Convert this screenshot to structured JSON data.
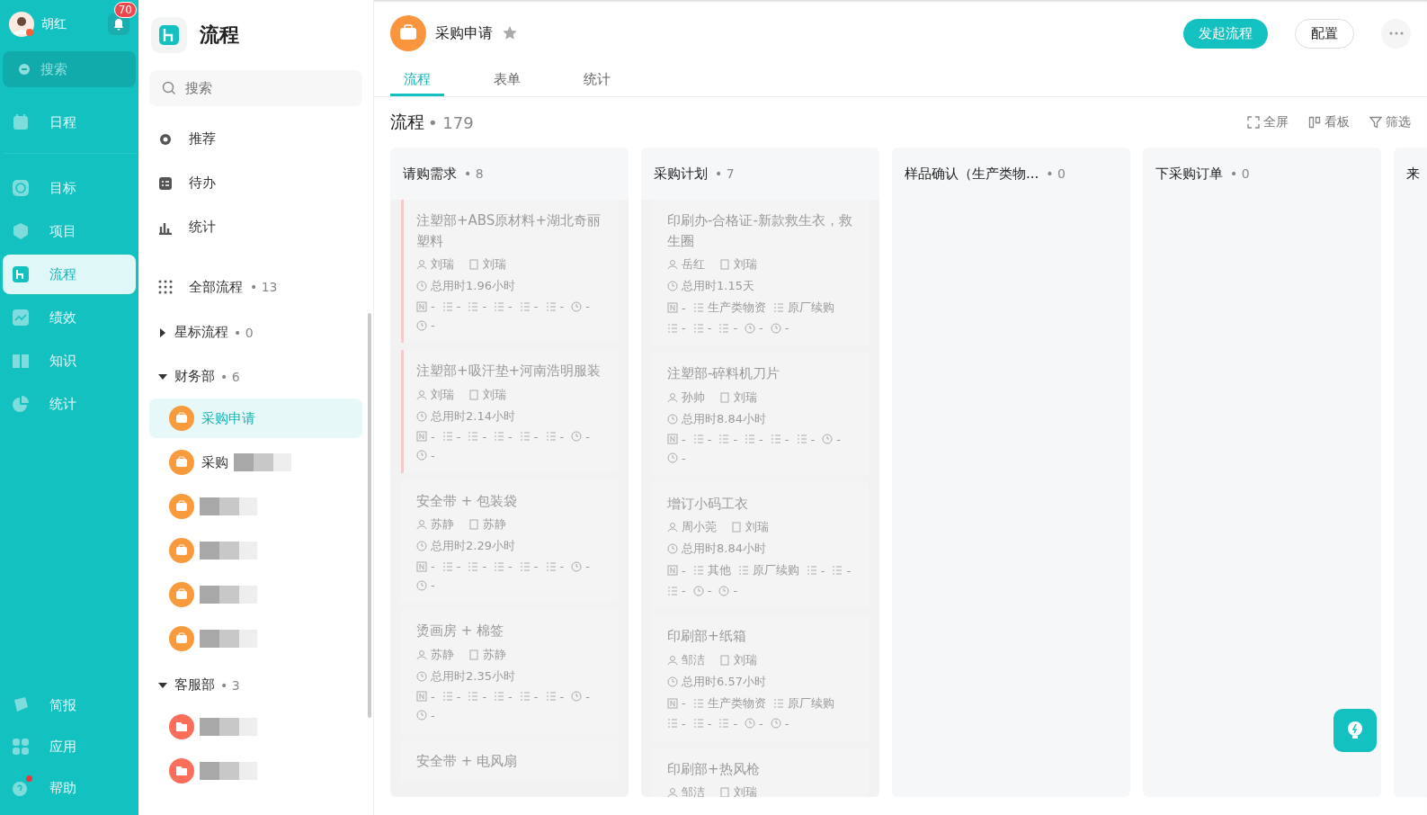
{
  "user": {
    "name": "胡红",
    "notifications": "70"
  },
  "nav": {
    "search": "搜索",
    "items": [
      {
        "label": "日程",
        "selected": false
      },
      {
        "label": "目标",
        "selected": false
      },
      {
        "label": "项目",
        "selected": false
      },
      {
        "label": "流程",
        "selected": true
      },
      {
        "label": "绩效",
        "selected": false
      },
      {
        "label": "知识",
        "selected": false
      },
      {
        "label": "统计",
        "selected": false
      }
    ],
    "bottom": [
      {
        "label": "简报",
        "selected": false,
        "dot": false
      },
      {
        "label": "应用",
        "selected": false,
        "dot": false
      },
      {
        "label": "帮助",
        "selected": false,
        "dot": true
      }
    ]
  },
  "panel": {
    "title": "流程",
    "search_placeholder": "搜索",
    "links": [
      {
        "label": "推荐"
      },
      {
        "label": "待办"
      },
      {
        "label": "统计"
      }
    ],
    "all": {
      "label": "全部流程",
      "count": "• 13"
    },
    "groups": [
      {
        "name": "星标流程",
        "count": "• 0",
        "expanded": false
      },
      {
        "name": "财务部",
        "count": "• 6",
        "expanded": true,
        "children": [
          {
            "label": "采购申请",
            "selected": true,
            "redacted": false
          },
          {
            "label": "采购",
            "selected": false,
            "redacted": true
          },
          {
            "selected": false,
            "redacted": true
          },
          {
            "selected": false,
            "redacted": true
          },
          {
            "selected": false,
            "redacted": true
          },
          {
            "selected": false,
            "redacted": true
          }
        ]
      },
      {
        "name": "客服部",
        "count": "• 3",
        "expanded": true,
        "children": [
          {
            "selected": false,
            "redacted": true
          },
          {
            "selected": false,
            "redacted": true
          }
        ]
      }
    ]
  },
  "header": {
    "title": "采购申请",
    "starred": false,
    "buttons": [
      {
        "label": "发起流程",
        "kind": "primary"
      },
      {
        "label": "配置",
        "kind": "outline"
      }
    ]
  },
  "tabs": [
    {
      "label": "流程",
      "selected": true
    },
    {
      "label": "表单",
      "selected": false
    },
    {
      "label": "统计",
      "selected": false
    }
  ],
  "board": {
    "title": "流程",
    "count": "• 179",
    "tools": [
      {
        "label": "全屏"
      },
      {
        "label": "看板"
      },
      {
        "label": "筛选"
      }
    ],
    "columns": [
      {
        "name": "请购需求",
        "count": "• 8",
        "cards": [
          {
            "title": "注塑部+ABS原材料+湖北奇丽塑料",
            "urgent": true,
            "applicant": "刘瑞",
            "handler": "刘瑞",
            "time": "总用时1.96小时",
            "fields": [
              "-",
              "-",
              "-",
              "-",
              "-",
              "-"
            ],
            "times": [
              "-",
              "-"
            ]
          },
          {
            "title": "注塑部+吸汗垫+河南浩明服装",
            "urgent": true,
            "applicant": "刘瑞",
            "handler": "刘瑞",
            "time": "总用时2.14小时",
            "fields": [
              "-",
              "-",
              "-",
              "-",
              "-",
              "-"
            ],
            "times": [
              "-",
              "-"
            ]
          },
          {
            "title": "安全带 + 包装袋",
            "urgent": false,
            "applicant": "苏静",
            "handler": "苏静",
            "time": "总用时2.29小时",
            "fields": [
              "-",
              "-",
              "-",
              "-",
              "-",
              "-"
            ],
            "times": [
              "-",
              "-"
            ]
          },
          {
            "title": "烫画房 + 棉签",
            "urgent": false,
            "applicant": "苏静",
            "handler": "苏静",
            "time": "总用时2.35小时",
            "fields": [
              "-",
              "-",
              "-",
              "-",
              "-",
              "-"
            ],
            "times": [
              "-",
              "-"
            ]
          },
          {
            "title": "安全带 + 电风扇",
            "urgent": false
          }
        ]
      },
      {
        "name": "采购计划",
        "count": "• 7",
        "cards": [
          {
            "title": "印刷办-合格证-新款救生衣，救生圈",
            "urgent": false,
            "applicant": "岳红",
            "handler": "刘瑞",
            "time": "总用时1.15天",
            "fields": [
              "-",
              "生产类物资",
              "原厂续购",
              "-",
              "-",
              "-"
            ],
            "times": [
              "-",
              "-"
            ]
          },
          {
            "title": "注塑部-碎料机刀片",
            "urgent": false,
            "applicant": "孙帅",
            "handler": "刘瑞",
            "time": "总用时8.84小时",
            "fields": [
              "-",
              "-",
              "-",
              "-",
              "-",
              "-"
            ],
            "times": [
              "-",
              "-"
            ]
          },
          {
            "title": "增订小码工衣",
            "urgent": false,
            "applicant": "周小莞",
            "handler": "刘瑞",
            "time": "总用时8.84小时",
            "fields": [
              "-",
              "其他",
              "原厂续购",
              "-",
              "-",
              "-"
            ],
            "times": [
              "-",
              "-"
            ]
          },
          {
            "title": "印刷部+纸箱",
            "urgent": false,
            "applicant": "邹洁",
            "handler": "刘瑞",
            "time": "总用时6.57小时",
            "fields": [
              "-",
              "生产类物资",
              "原厂续购",
              "-",
              "-",
              "-"
            ],
            "times": [
              "-",
              "-"
            ]
          },
          {
            "title": "印刷部+热风枪",
            "urgent": false,
            "applicant": "邹洁",
            "handler": "刘瑞"
          }
        ]
      },
      {
        "name": "样品确认（生产类物...",
        "count": "• 0"
      },
      {
        "name": "下采购订单",
        "count": "• 0"
      },
      {
        "name": "来"
      }
    ]
  }
}
